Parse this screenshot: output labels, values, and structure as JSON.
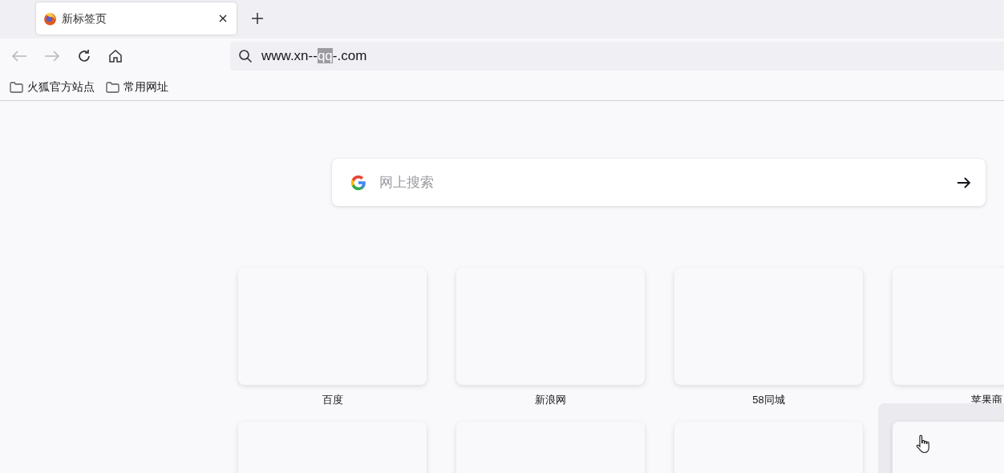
{
  "tabs": [
    {
      "title": "新标签页",
      "selected": true
    }
  ],
  "toolbar": {
    "back_disabled": true,
    "forward_disabled": true
  },
  "address_bar": {
    "url": [
      {
        "text": "www.xn--",
        "selected": false
      },
      {
        "text": "qq",
        "selected": true
      },
      {
        "text": "-.com",
        "selected": false
      }
    ]
  },
  "bookmarks": [
    "火狐官方站点",
    "常用网址"
  ],
  "search": {
    "placeholder": "网上搜索"
  },
  "top_sites": [
    {
      "label": "百度",
      "hovered": false
    },
    {
      "label": "新浪网",
      "hovered": false
    },
    {
      "label": "58同城",
      "hovered": false
    },
    {
      "label": "苹果商",
      "hovered": false
    },
    {
      "hovered": false
    },
    {
      "hovered": false
    },
    {
      "hovered": false
    },
    {
      "hovered": true
    }
  ]
}
